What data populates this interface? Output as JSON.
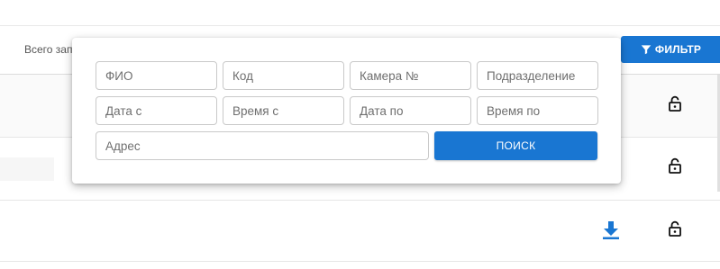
{
  "table": {
    "total_label": "Всего зап"
  },
  "toolbar": {
    "filter_label": "ФИЛЬТР",
    "filter_icon": "funnel-icon"
  },
  "filter_form": {
    "fio_placeholder": "ФИО",
    "code_placeholder": "Код",
    "camera_placeholder": "Камера №",
    "department_placeholder": "Подразделение",
    "date_from_placeholder": "Дата с",
    "time_from_placeholder": "Время с",
    "date_to_placeholder": "Дата по",
    "time_to_placeholder": "Время по",
    "address_placeholder": "Адрес",
    "search_label": "ПОИСК"
  },
  "icons": {
    "lock": "lock-open-icon",
    "download": "download-icon"
  },
  "colors": {
    "accent": "#1976d2",
    "border": "#c9c9c9",
    "text_muted": "#6f6f6f"
  }
}
